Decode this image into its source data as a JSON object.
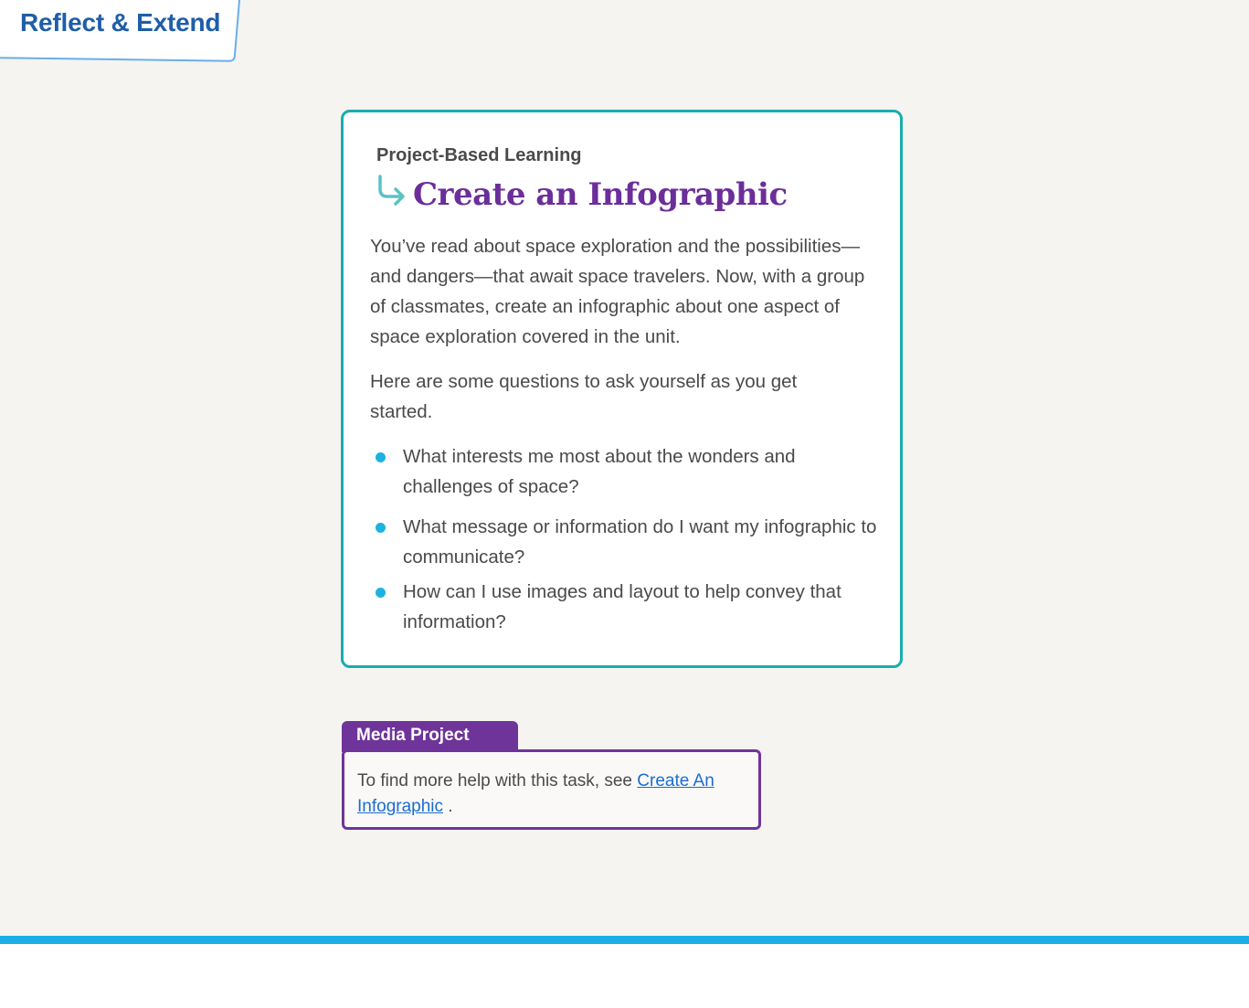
{
  "header": {
    "title": "Reflect & Extend"
  },
  "card": {
    "eyebrow": "Project-Based Learning",
    "title": "Create an Infographic",
    "icon": "arrow-turn-down-right-icon",
    "paragraphs": [
      "You’ve read about space exploration and the possibilities—and dangers—that await space travelers. Now, with a group of classmates, create an infographic about one aspect of space exploration covered in the unit.",
      "Here are some questions to ask yourself as you get started."
    ],
    "bullets": [
      "What interests me most about the wonders and challenges of space?",
      "What message or information do I want my infographic to communicate?",
      "How can I use images and layout to help convey that information?"
    ]
  },
  "media_project": {
    "tab_label": "Media Project",
    "text_before": "To find more help with this task, see ",
    "link_text": "Create An Infographic",
    "text_after": " ."
  },
  "colors": {
    "header_blue": "#1f5ea8",
    "card_border": "#1aacae",
    "title_purple": "#6b2e9a",
    "bullet_blue": "#1eb2e0",
    "media_purple": "#6f3499",
    "link_blue": "#1a6dd1",
    "footer_bar": "#19afe6"
  }
}
